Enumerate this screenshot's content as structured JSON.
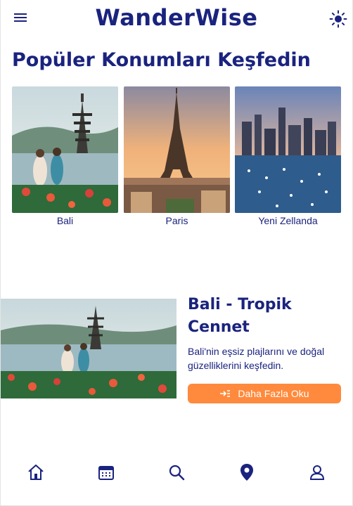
{
  "app": {
    "title": "WanderWise"
  },
  "header": {
    "menu_icon": "menu-icon",
    "theme_icon": "sun-icon"
  },
  "popular": {
    "title": "Popüler Konumları Keşfedin",
    "locations": [
      {
        "label": "Bali"
      },
      {
        "label": "Paris"
      },
      {
        "label": "Yeni Zellanda"
      }
    ]
  },
  "featured": {
    "title": "Bali - Tropik Cennet",
    "description": "Bali'nin eşsiz plajlarını ve doğal güzelliklerini keşfedin.",
    "button_label": "Daha Fazla Oku",
    "button_icon": "read-more-icon"
  },
  "bottom_nav": {
    "items": [
      "home-icon",
      "calendar-icon",
      "search-icon",
      "location-pin-icon",
      "profile-icon"
    ]
  },
  "colors": {
    "primary": "#1a237e",
    "accent": "#ff8a3d",
    "background": "#ffffff"
  }
}
